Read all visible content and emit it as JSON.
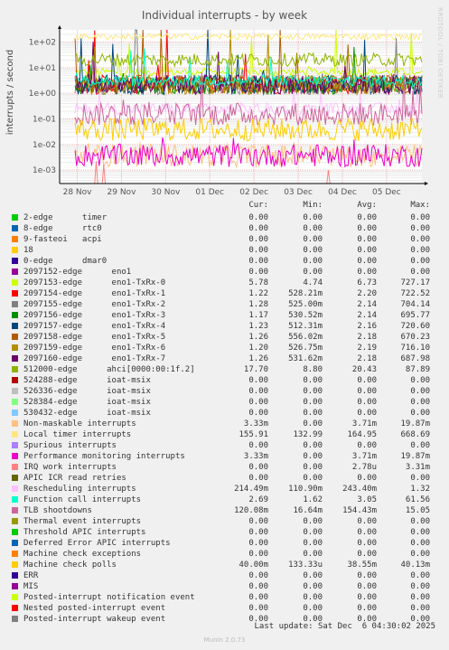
{
  "title": "Individual interrupts - by week",
  "side_text": "RRDTOOL / TOBI OETIKER",
  "footer": {
    "last_update": "Last update: Sat Dec  6 04:30:02 2025",
    "version": "Munin 2.0.73"
  },
  "legend_headers": {
    "cur": "Cur:",
    "min": "Min:",
    "avg": "Avg:",
    "max": "Max:"
  },
  "chart_data": {
    "type": "line",
    "title": "Individual interrupts - by week",
    "ylabel": "interrupts / second",
    "yscale": "log",
    "ylim": [
      0.0003,
      300
    ],
    "y_ticks": [
      "1e-03",
      "1e-02",
      "1e-01",
      "1e+00",
      "1e+01",
      "1e+02"
    ],
    "y_tick_values": [
      0.001,
      0.01,
      0.1,
      1,
      10,
      100
    ],
    "x_ticks": [
      "28 Nov",
      "29 Nov",
      "30 Nov",
      "01 Dec",
      "02 Dec",
      "03 Dec",
      "04 Dec",
      "05 Dec"
    ],
    "x_tick_values": [
      0.4,
      1.4,
      2.4,
      3.4,
      4.4,
      5.4,
      6.4,
      7.4
    ],
    "xlim": [
      0,
      8.2
    ],
    "grid": true,
    "legend_position": "bottom",
    "series": [
      {
        "name": "2-edge      timer",
        "color": "#00cc00",
        "cur": "0.00",
        "min": "0.00",
        "avg": "0.00",
        "max": "0.00"
      },
      {
        "name": "8-edge      rtc0",
        "color": "#0066b3",
        "cur": "0.00",
        "min": "0.00",
        "avg": "0.00",
        "max": "0.00"
      },
      {
        "name": "9-fasteoi   acpi",
        "color": "#ff8000",
        "cur": "0.00",
        "min": "0.00",
        "avg": "0.00",
        "max": "0.00"
      },
      {
        "name": "18",
        "color": "#ffcc00",
        "cur": "0.00",
        "min": "0.00",
        "avg": "0.00",
        "max": "0.00"
      },
      {
        "name": "0-edge      dmar0",
        "color": "#330099",
        "cur": "0.00",
        "min": "0.00",
        "avg": "0.00",
        "max": "0.00"
      },
      {
        "name": "2097152-edge      eno1",
        "color": "#990099",
        "cur": "0.00",
        "min": "0.00",
        "avg": "0.00",
        "max": "0.00"
      },
      {
        "name": "2097153-edge      eno1-TxRx-0",
        "color": "#ccff00",
        "cur": "5.78",
        "min": "4.74",
        "avg": "6.73",
        "max": "727.17"
      },
      {
        "name": "2097154-edge      eno1-TxRx-1",
        "color": "#ff0000",
        "cur": "1.22",
        "min": "528.21m",
        "avg": "2.20",
        "max": "722.52"
      },
      {
        "name": "2097155-edge      eno1-TxRx-2",
        "color": "#808080",
        "cur": "1.28",
        "min": "525.00m",
        "avg": "2.14",
        "max": "704.14"
      },
      {
        "name": "2097156-edge      eno1-TxRx-3",
        "color": "#008f00",
        "cur": "1.17",
        "min": "530.52m",
        "avg": "2.14",
        "max": "695.77"
      },
      {
        "name": "2097157-edge      eno1-TxRx-4",
        "color": "#00487d",
        "cur": "1.23",
        "min": "512.31m",
        "avg": "2.16",
        "max": "720.60"
      },
      {
        "name": "2097158-edge      eno1-TxRx-5",
        "color": "#b35a00",
        "cur": "1.26",
        "min": "556.02m",
        "avg": "2.18",
        "max": "670.23"
      },
      {
        "name": "2097159-edge      eno1-TxRx-6",
        "color": "#b38f00",
        "cur": "1.20",
        "min": "526.75m",
        "avg": "2.19",
        "max": "716.10"
      },
      {
        "name": "2097160-edge      eno1-TxRx-7",
        "color": "#6b006b",
        "cur": "1.26",
        "min": "531.62m",
        "avg": "2.18",
        "max": "687.98"
      },
      {
        "name": "512000-edge      ahci[0000:00:1f.2]",
        "color": "#8fb300",
        "cur": "17.70",
        "min": "8.80",
        "avg": "20.43",
        "max": "87.89"
      },
      {
        "name": "524288-edge      ioat-msix",
        "color": "#b30000",
        "cur": "0.00",
        "min": "0.00",
        "avg": "0.00",
        "max": "0.00"
      },
      {
        "name": "526336-edge      ioat-msix",
        "color": "#bebebe",
        "cur": "0.00",
        "min": "0.00",
        "avg": "0.00",
        "max": "0.00"
      },
      {
        "name": "528384-edge      ioat-msix",
        "color": "#80ff80",
        "cur": "0.00",
        "min": "0.00",
        "avg": "0.00",
        "max": "0.00"
      },
      {
        "name": "530432-edge      ioat-msix",
        "color": "#80c9ff",
        "cur": "0.00",
        "min": "0.00",
        "avg": "0.00",
        "max": "0.00"
      },
      {
        "name": "Non-maskable interrupts",
        "color": "#ffc080",
        "cur": "3.33m",
        "min": "0.00",
        "avg": "3.71m",
        "max": "19.87m"
      },
      {
        "name": "Local timer interrupts",
        "color": "#ffe680",
        "cur": "155.91",
        "min": "132.99",
        "avg": "164.95",
        "max": "668.69"
      },
      {
        "name": "Spurious interrupts",
        "color": "#aa80ff",
        "cur": "0.00",
        "min": "0.00",
        "avg": "0.00",
        "max": "0.00"
      },
      {
        "name": "Performance monitoring interrupts",
        "color": "#ee00cc",
        "cur": "3.33m",
        "min": "0.00",
        "avg": "3.71m",
        "max": "19.87m"
      },
      {
        "name": "IRQ work interrupts",
        "color": "#ff8080",
        "cur": "0.00",
        "min": "0.00",
        "avg": "2.78u",
        "max": "3.31m"
      },
      {
        "name": "APIC ICR read retries",
        "color": "#666600",
        "cur": "0.00",
        "min": "0.00",
        "avg": "0.00",
        "max": "0.00"
      },
      {
        "name": "Rescheduling interrupts",
        "color": "#ffbfff",
        "cur": "214.49m",
        "min": "110.90m",
        "avg": "243.40m",
        "max": "1.32"
      },
      {
        "name": "Function call interrupts",
        "color": "#00ffcc",
        "cur": "2.69",
        "min": "1.62",
        "avg": "3.05",
        "max": "61.56"
      },
      {
        "name": "TLB shootdowns",
        "color": "#cc6699",
        "cur": "120.08m",
        "min": "16.64m",
        "avg": "154.43m",
        "max": "15.05"
      },
      {
        "name": "Thermal event interrupts",
        "color": "#999900",
        "cur": "0.00",
        "min": "0.00",
        "avg": "0.00",
        "max": "0.00"
      },
      {
        "name": "Threshold APIC interrupts",
        "color": "#00cc00",
        "cur": "0.00",
        "min": "0.00",
        "avg": "0.00",
        "max": "0.00"
      },
      {
        "name": "Deferred Error APIC interrupts",
        "color": "#0066b3",
        "cur": "0.00",
        "min": "0.00",
        "avg": "0.00",
        "max": "0.00"
      },
      {
        "name": "Machine check exceptions",
        "color": "#ff8000",
        "cur": "0.00",
        "min": "0.00",
        "avg": "0.00",
        "max": "0.00"
      },
      {
        "name": "Machine check polls",
        "color": "#ffcc00",
        "cur": "40.00m",
        "min": "133.33u",
        "avg": "38.55m",
        "max": "40.13m"
      },
      {
        "name": "ERR",
        "color": "#330099",
        "cur": "0.00",
        "min": "0.00",
        "avg": "0.00",
        "max": "0.00"
      },
      {
        "name": "MIS",
        "color": "#990099",
        "cur": "0.00",
        "min": "0.00",
        "avg": "0.00",
        "max": "0.00"
      },
      {
        "name": "Posted-interrupt notification event",
        "color": "#ccff00",
        "cur": "0.00",
        "min": "0.00",
        "avg": "0.00",
        "max": "0.00"
      },
      {
        "name": "Nested posted-interrupt event",
        "color": "#ff0000",
        "cur": "0.00",
        "min": "0.00",
        "avg": "0.00",
        "max": "0.00"
      },
      {
        "name": "Posted-interrupt wakeup event",
        "color": "#808080",
        "cur": "0.00",
        "min": "0.00",
        "avg": "0.00",
        "max": "0.00"
      }
    ]
  }
}
